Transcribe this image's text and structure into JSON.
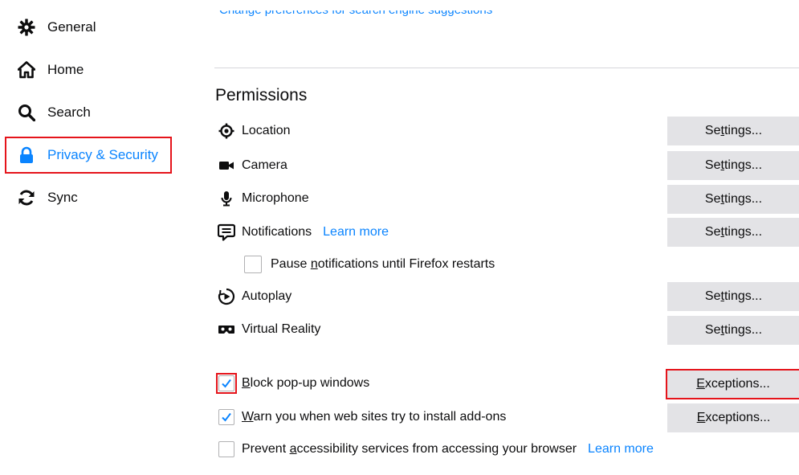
{
  "sidebar": {
    "items": [
      {
        "label": "General",
        "icon": "gear-icon"
      },
      {
        "label": "Home",
        "icon": "home-icon"
      },
      {
        "label": "Search",
        "icon": "search-icon"
      },
      {
        "label": "Privacy & Security",
        "icon": "lock-icon",
        "selected": true
      },
      {
        "label": "Sync",
        "icon": "sync-icon"
      }
    ]
  },
  "main": {
    "top_link": "Change preferences for search engine suggestions",
    "permissions_title": "Permissions",
    "permissions": [
      {
        "label": "Location",
        "icon": "location-icon",
        "button": "Settings..."
      },
      {
        "label": "Camera",
        "icon": "camera-icon",
        "button": "Settings..."
      },
      {
        "label": "Microphone",
        "icon": "microphone-icon",
        "button": "Settings..."
      },
      {
        "label": "Notifications",
        "icon": "notifications-icon",
        "button": "Settings...",
        "learn_more": "Learn more"
      },
      {
        "label": "Autoplay",
        "icon": "autoplay-icon",
        "button": "Settings..."
      },
      {
        "label": "Virtual Reality",
        "icon": "virtual-reality-icon",
        "button": "Settings..."
      }
    ],
    "pause_notifications": {
      "label": "Pause notifications until Firefox restarts",
      "checked": false
    },
    "block_popups": {
      "label": "Block pop-up windows",
      "checked": true,
      "button": "Exceptions..."
    },
    "warn_addons": {
      "label": "Warn you when web sites try to install add-ons",
      "checked": true,
      "button": "Exceptions..."
    },
    "prevent_accessibility": {
      "label": "Prevent accessibility services from accessing your browser",
      "checked": false,
      "learn_more": "Learn more"
    }
  },
  "colors": {
    "accent": "#0a84ff",
    "highlight": "#e5141b",
    "button_bg": "#e3e3e6",
    "divider": "#d7d7db"
  }
}
